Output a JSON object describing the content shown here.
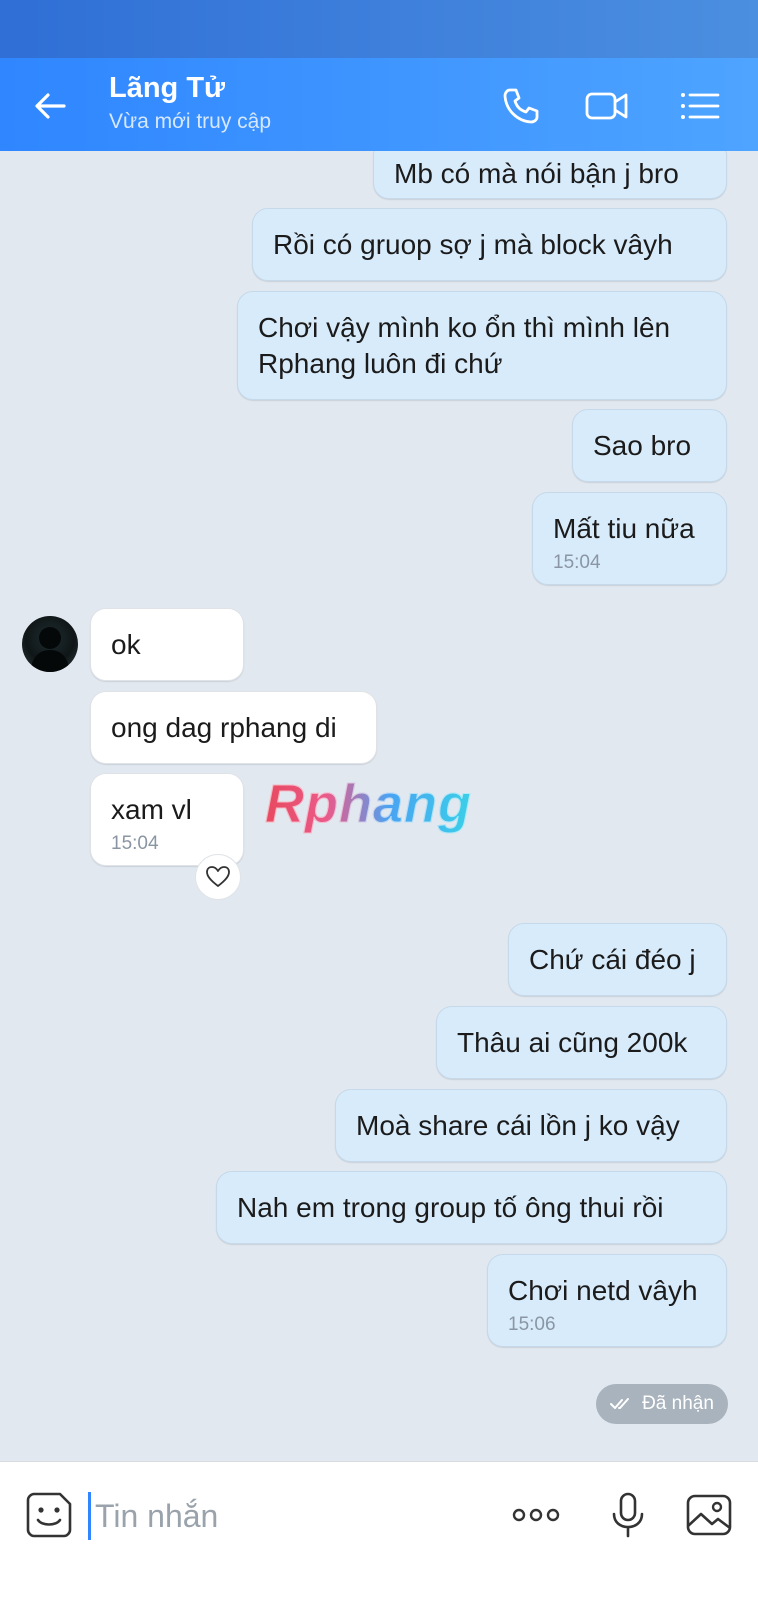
{
  "header": {
    "title": "Lãng Tử",
    "subtitle": "Vừa mới truy cập"
  },
  "messages": [
    {
      "side": "out",
      "text": "Mb có mà nói bận j bro"
    },
    {
      "side": "out",
      "text": "Rồi có gruop sợ j mà block vâyh"
    },
    {
      "side": "out",
      "text": "Chơi vậy mình ko ổn thì mình lên\nRphang luôn đi chứ"
    },
    {
      "side": "out",
      "text": "Sao bro"
    },
    {
      "side": "out",
      "text": "Mất tiu nữa",
      "time": "15:04"
    },
    {
      "side": "in",
      "text": "ok"
    },
    {
      "side": "in",
      "text": "ong dag rphang di"
    },
    {
      "side": "in",
      "text": "xam vl",
      "time": "15:04"
    },
    {
      "side": "out",
      "text": "Chứ cái đéo j"
    },
    {
      "side": "out",
      "text": "Thâu ai cũng 200k"
    },
    {
      "side": "out",
      "text": "Moà share cái lồn j ko vậy"
    },
    {
      "side": "out",
      "text": "Nah em trong group tố ông thui rồi"
    },
    {
      "side": "out",
      "text": "Chơi netd vâyh",
      "time": "15:06"
    }
  ],
  "status": "Đã nhận",
  "watermark": "Rphang",
  "input": {
    "placeholder": "Tin nhắn"
  },
  "colors": {
    "header": "#3a92ff",
    "outgoing_bubble": "#d8ebfb",
    "incoming_bubble": "#ffffff",
    "background": "#e2e8f0"
  }
}
